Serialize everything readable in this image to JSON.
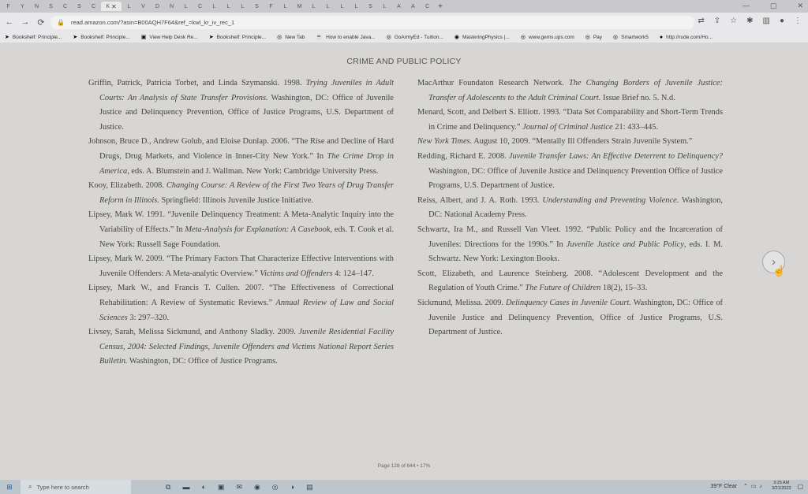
{
  "browser": {
    "tabs": [
      {
        "icon": "F"
      },
      {
        "icon": "Y"
      },
      {
        "icon": "N"
      },
      {
        "icon": "S"
      },
      {
        "icon": "C"
      },
      {
        "icon": "S"
      },
      {
        "icon": "C"
      },
      {
        "icon": "K",
        "active": true,
        "close": "✕"
      },
      {
        "icon": "L"
      },
      {
        "icon": "V"
      },
      {
        "icon": "D"
      },
      {
        "icon": "N"
      },
      {
        "icon": "L"
      },
      {
        "icon": "C"
      },
      {
        "icon": "L"
      },
      {
        "icon": "L"
      },
      {
        "icon": "L"
      },
      {
        "icon": "S"
      },
      {
        "icon": "F"
      },
      {
        "icon": "L"
      },
      {
        "icon": "M"
      },
      {
        "icon": "L"
      },
      {
        "icon": "L"
      },
      {
        "icon": "L"
      },
      {
        "icon": "L"
      },
      {
        "icon": "S"
      },
      {
        "icon": "L"
      },
      {
        "icon": "A"
      },
      {
        "icon": "A"
      },
      {
        "icon": "C"
      }
    ],
    "new_tab": "+",
    "url": "read.amazon.com/?asin=B00AQH7F64&ref_=kwl_kr_iv_rec_1",
    "bookmarks": [
      "Bookshelf: Principle...",
      "Bookshelf: Principle...",
      "View Help Desk Re...",
      "Bookshelf: Principle...",
      "New Tab",
      "How to enable Java...",
      "GoArmyEd - Tuition...",
      "MasteringPhysics |...",
      "www.gems.ups.com",
      "Pay",
      "Smartwork5",
      "http://rude.com/Ho..."
    ]
  },
  "reader": {
    "running_head": "CRIME AND PUBLIC POLICY",
    "page_footer": "Page 128 of 644 • 17%",
    "left_column": [
      "Griffin, Patrick, Patricia Torbet, and Linda Szymanski. 1998. <i>Trying Juveniles in Adult Courts: An Analysis of State Transfer Provisions.</i> Washington, DC: Office of Juvenile Justice and Delinquency Prevention, Office of Justice Programs, U.S. Department of Justice.",
      "Johnson, Bruce D., Andrew Golub, and Eloise Dunlap. 2006. “The Rise and Decline of Hard Drugs, Drug Markets, and Violence in Inner-City New York.” In <i>The Crime Drop in America</i>, eds. A. Blumstein and J. Wallman. New York: Cambridge University Press.",
      "Kooy, Elizabeth. 2008. <i>Changing Course: A Review of the First Two Years of Drug Transfer Reform in Illinois.</i> Springfield: Illinois Juvenile Justice Initiative.",
      "Lipsey, Mark W. 1991. “Juvenile Delinquency Treatment: A Meta-Analytic Inquiry into the Variability of Effects.” In <i>Meta-Analysis for Explanation: A Casebook</i>, eds. T. Cook et al. New York: Russell Sage Foundation.",
      "Lipsey, Mark W. 2009. “The Primary Factors That Characterize Effective Interventions with Juvenile Offenders: A Meta-analytic Overview.” <i>Victims and Offenders</i> 4: 124–147.",
      "Lipsey, Mark W., and Francis T. Cullen. 2007. “The Effectiveness of Correctional Rehabilitation: A Review of Systematic Reviews.” <i>Annual Review of Law and Social Sciences</i> 3: 297–320.",
      "Livsey, Sarah, Melissa Sickmund, and Anthony Sladky. 2009. <i>Juvenile Residential Facility Census, 2004: Selected Findings, Juvenile Offenders and Victims National Report Series Bulletin.</i> Washington, DC: Office of Justice Programs."
    ],
    "right_column": [
      "MacArthur Foundaton Research Network. <i>The Changing Borders of Juvenile Justice: Transfer of Adolescents to the Adult Criminal Court.</i> Issue Brief no. 5. N.d.",
      "Menard, Scott, and Delbert S. Elliott. 1993. “Data Set Comparability and Short-Term Trends in Crime and Delinquency.” <i>Journal of Criminal Justice</i> 21: 433–445.",
      "<i>New York Times.</i> August 10, 2009. “Mentally Ill Offenders Strain Juvenile System.”",
      "Redding, Richard E. 2008. <i>Juvenile Transfer Laws: An Effective Deterrent to Delinquency?</i> Washington, DC: Office of Juvenile Justice and Delinquency Prevention Office of Justice Programs, U.S. Department of Justice.",
      "Reiss, Albert, and J. A. Roth. 1993. <i>Understanding and Preventing Violence.</i> Washington, DC: National Academy Press.",
      "Schwartz, Ira M., and Russell Van Vleet. 1992. “Public Policy and the Incarceration of Juveniles: Directions for the 1990s.” In <i>Juvenile Justice and Public Policy</i>, eds. I. M. Schwartz. New York: Lexington Books.",
      "Scott, Elizabeth, and Laurence Steinberg. 2008. “Adolescent Development and the Regulation of Youth Crime.” <i>The Future of Children</i> 18(2), 15–33.",
      "Sickmund, Melissa. 2009. <i>Delinquency Cases in Juvenile Court.</i> Washington, DC: Office of Juvenile Justice and Delinquency Prevention, Office of Justice Programs, U.S. Department of Justice."
    ],
    "next_button": "›"
  },
  "taskbar": {
    "search_placeholder": "Type here to search",
    "weather": "39°F Clear",
    "time": "3:25 AM",
    "date": "3/21/2023"
  },
  "icons": {
    "back": "arrow-left-icon",
    "forward": "arrow-right-icon",
    "reload": "reload-icon",
    "lock": "lock-icon",
    "bookmark_star": "star-icon",
    "extensions": "puzzle-icon",
    "profile": "avatar-icon",
    "menu": "kebab-menu-icon",
    "start": "windows-start-icon",
    "search": "search-icon",
    "next_page": "chevron-right-icon"
  }
}
